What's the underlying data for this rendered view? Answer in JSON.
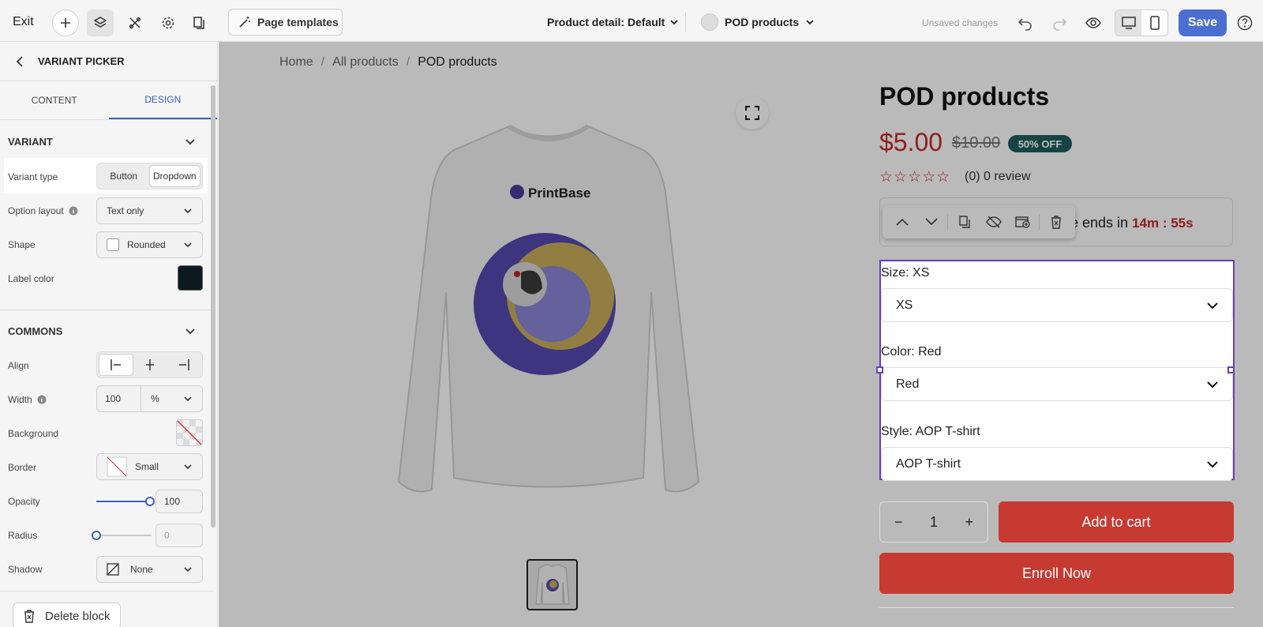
{
  "topbar": {
    "exit_label": "Exit",
    "page_templates_label": "Page templates",
    "page_title": "Product detail: Default",
    "store_selector": "POD products",
    "status": "Unsaved changes",
    "save_label": "Save"
  },
  "sidebar": {
    "header_title": "VARIANT PICKER",
    "tabs": [
      {
        "label": "CONTENT"
      },
      {
        "label": "DESIGN"
      }
    ],
    "variant_section": {
      "title": "VARIANT",
      "variant_type_label": "Variant type",
      "variant_type_options": [
        "Button",
        "Dropdown"
      ],
      "variant_type_selected": "Dropdown",
      "option_layout_label": "Option layout",
      "option_layout_value": "Text only",
      "shape_label": "Shape",
      "shape_value": "Rounded",
      "label_color_label": "Label color",
      "label_color": "#0d1a1f"
    },
    "commons_section": {
      "title": "COMMONS",
      "align_label": "Align",
      "width_label": "Width",
      "width_value": "100",
      "width_unit": "%",
      "background_label": "Background",
      "border_label": "Border",
      "border_value": "Small",
      "opacity_label": "Opacity",
      "opacity_value": "100",
      "radius_label": "Radius",
      "radius_value": "0",
      "shadow_label": "Shadow",
      "shadow_value": "None"
    },
    "delete_label": "Delete block"
  },
  "canvas": {
    "breadcrumb": [
      "Home",
      "All products",
      "POD products"
    ],
    "product_title": "POD products",
    "price": "$5.00",
    "old_price": "$10.00",
    "discount_badge": "50% OFF",
    "reviews": "(0) 0 review",
    "timer_text": "e ends in",
    "timer_value": "14m : 55s",
    "shirt_brand": "PrintBase",
    "variants": [
      {
        "label": "Size: XS",
        "value": "XS"
      },
      {
        "label": "Color: Red",
        "value": "Red"
      },
      {
        "label": "Style: AOP T-shirt",
        "value": "AOP T-shirt"
      }
    ],
    "quantity": "1",
    "qty_minus": "−",
    "qty_plus": "+",
    "add_to_cart": "Add to cart",
    "enroll_now": "Enroll Now"
  },
  "colors": {
    "accent": "#3b5fbf",
    "save_button": "#4a6fd1",
    "price_red": "#c62828",
    "cta_red": "#c63a32",
    "badge_teal": "#1f5c5c",
    "selection_purple": "#6a3cc2"
  }
}
